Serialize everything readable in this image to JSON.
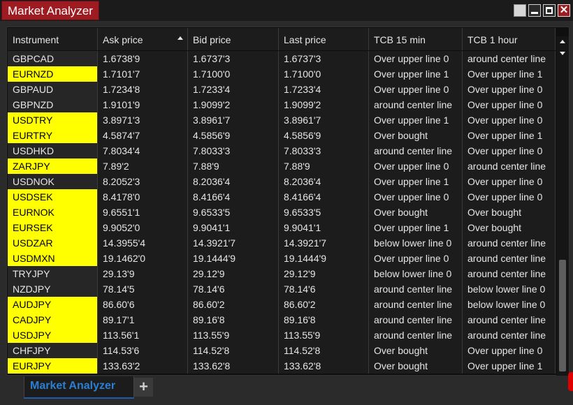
{
  "window": {
    "title": "Market Analyzer",
    "controls": [
      "blank-icon",
      "minimize-icon",
      "maximize-icon",
      "close-icon"
    ],
    "close_glyph": "✕"
  },
  "colors": {
    "highlight": "#ffff00",
    "title_accent": "#9e1b22",
    "tab_accent": "#2a7fd4"
  },
  "table": {
    "columns": [
      "Instrument",
      "Ask price",
      "Bid price",
      "Last price",
      "TCB 15 min",
      "TCB 1 hour"
    ],
    "sorted_column": "Ask price",
    "sort_direction": "ascending",
    "rows": [
      {
        "instrument": "GBPCAD",
        "highlight": false,
        "ask": "1.6738'9",
        "bid": "1.6737'3",
        "last": "1.6737'3",
        "tcb15": "Over upper line 0",
        "tcb1h": "around center line"
      },
      {
        "instrument": "EURNZD",
        "highlight": true,
        "ask": "1.7101'7",
        "bid": "1.7100'0",
        "last": "1.7100'0",
        "tcb15": "Over upper line 1",
        "tcb1h": "Over upper line 1"
      },
      {
        "instrument": "GBPAUD",
        "highlight": false,
        "ask": "1.7234'8",
        "bid": "1.7233'4",
        "last": "1.7233'4",
        "tcb15": "Over upper line 0",
        "tcb1h": "Over upper line 0"
      },
      {
        "instrument": "GBPNZD",
        "highlight": false,
        "ask": "1.9101'9",
        "bid": "1.9099'2",
        "last": "1.9099'2",
        "tcb15": "around center line",
        "tcb1h": "Over upper line 0"
      },
      {
        "instrument": "USDTRY",
        "highlight": true,
        "ask": "3.8971'3",
        "bid": "3.8961'7",
        "last": "3.8961'7",
        "tcb15": "Over upper line 1",
        "tcb1h": "Over upper line 0"
      },
      {
        "instrument": "EURTRY",
        "highlight": true,
        "ask": "4.5874'7",
        "bid": "4.5856'9",
        "last": "4.5856'9",
        "tcb15": "Over bought",
        "tcb1h": "Over upper line 1"
      },
      {
        "instrument": "USDHKD",
        "highlight": false,
        "ask": "7.8034'4",
        "bid": "7.8033'3",
        "last": "7.8033'3",
        "tcb15": "around center line",
        "tcb1h": "Over upper line 0"
      },
      {
        "instrument": "ZARJPY",
        "highlight": true,
        "ask": "7.89'2",
        "bid": "7.88'9",
        "last": "7.88'9",
        "tcb15": "Over upper line 0",
        "tcb1h": "around center line"
      },
      {
        "instrument": "USDNOK",
        "highlight": false,
        "ask": "8.2052'3",
        "bid": "8.2036'4",
        "last": "8.2036'4",
        "tcb15": "Over upper line 1",
        "tcb1h": "Over upper line 0"
      },
      {
        "instrument": "USDSEK",
        "highlight": true,
        "ask": "8.4178'0",
        "bid": "8.4166'4",
        "last": "8.4166'4",
        "tcb15": "Over upper line 0",
        "tcb1h": "Over upper line 0"
      },
      {
        "instrument": "EURNOK",
        "highlight": true,
        "ask": "9.6551'1",
        "bid": "9.6533'5",
        "last": "9.6533'5",
        "tcb15": "Over bought",
        "tcb1h": "Over bought"
      },
      {
        "instrument": "EURSEK",
        "highlight": true,
        "ask": "9.9052'0",
        "bid": "9.9041'1",
        "last": "9.9041'1",
        "tcb15": "Over upper line 1",
        "tcb1h": "Over bought"
      },
      {
        "instrument": "USDZAR",
        "highlight": true,
        "ask": "14.3955'4",
        "bid": "14.3921'7",
        "last": "14.3921'7",
        "tcb15": "below lower line 0",
        "tcb1h": "around center line"
      },
      {
        "instrument": "USDMXN",
        "highlight": true,
        "ask": "19.1462'0",
        "bid": "19.1444'9",
        "last": "19.1444'9",
        "tcb15": "Over upper line 0",
        "tcb1h": "around center line"
      },
      {
        "instrument": "TRYJPY",
        "highlight": false,
        "ask": "29.13'9",
        "bid": "29.12'9",
        "last": "29.12'9",
        "tcb15": "below lower line 0",
        "tcb1h": "around center line"
      },
      {
        "instrument": "NZDJPY",
        "highlight": false,
        "ask": "78.14'5",
        "bid": "78.14'6",
        "last": "78.14'6",
        "tcb15": "around center line",
        "tcb1h": "below lower line 0"
      },
      {
        "instrument": "AUDJPY",
        "highlight": true,
        "ask": "86.60'6",
        "bid": "86.60'2",
        "last": "86.60'2",
        "tcb15": "around center line",
        "tcb1h": "below lower line 0"
      },
      {
        "instrument": "CADJPY",
        "highlight": true,
        "ask": "89.17'1",
        "bid": "89.16'8",
        "last": "89.16'8",
        "tcb15": "around center line",
        "tcb1h": "around center line"
      },
      {
        "instrument": "USDJPY",
        "highlight": true,
        "ask": "113.56'1",
        "bid": "113.55'9",
        "last": "113.55'9",
        "tcb15": "around center line",
        "tcb1h": "around center line"
      },
      {
        "instrument": "CHFJPY",
        "highlight": false,
        "ask": "114.53'6",
        "bid": "114.52'8",
        "last": "114.52'8",
        "tcb15": "Over bought",
        "tcb1h": "Over upper line 0"
      },
      {
        "instrument": "EURJPY",
        "highlight": true,
        "ask": "133.63'2",
        "bid": "133.62'8",
        "last": "133.62'8",
        "tcb15": "Over bought",
        "tcb1h": "Over upper line 1"
      }
    ]
  },
  "tabs": [
    {
      "label": "Market Analyzer",
      "active": true
    }
  ],
  "add_tab_label": "+"
}
